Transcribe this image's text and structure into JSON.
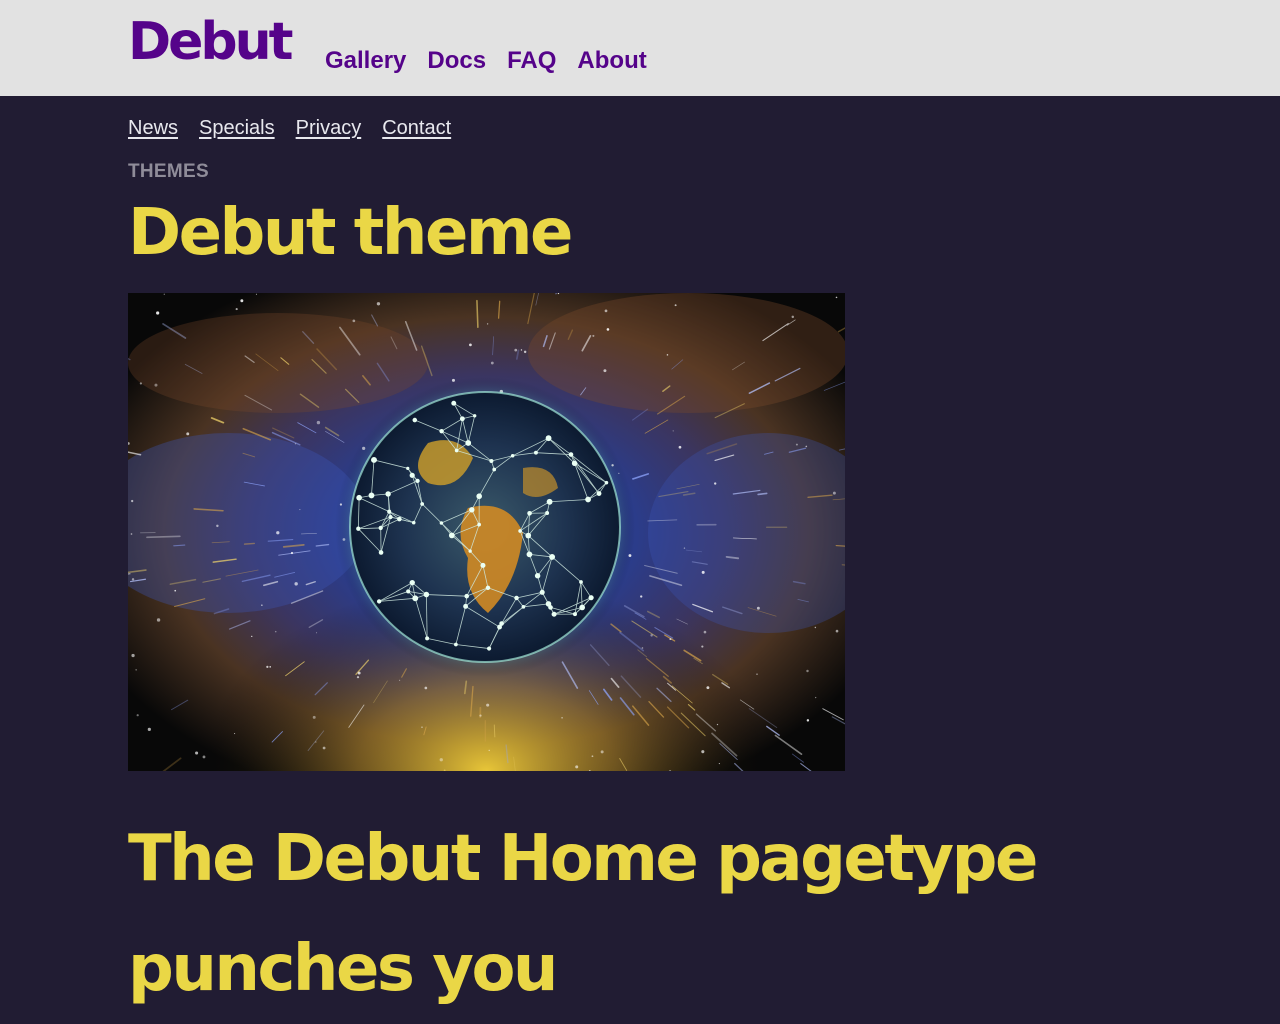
{
  "header": {
    "brand": "Debut",
    "nav": [
      "Gallery",
      "Docs",
      "FAQ",
      "About"
    ]
  },
  "subnav": [
    "News",
    "Specials",
    "Privacy",
    "Contact"
  ],
  "article": {
    "category": "THEMES",
    "title": "Debut theme",
    "hero_image": "globe-network-space-image",
    "headline": "The Debut Home pagetype punches you"
  },
  "colors": {
    "header_bg": "#e2e2e2",
    "page_bg": "#211c33",
    "brand_purple": "#55038a",
    "heading_yellow": "#ead746",
    "link_light": "#e8e8ee",
    "category_gray": "#8f8c99"
  }
}
